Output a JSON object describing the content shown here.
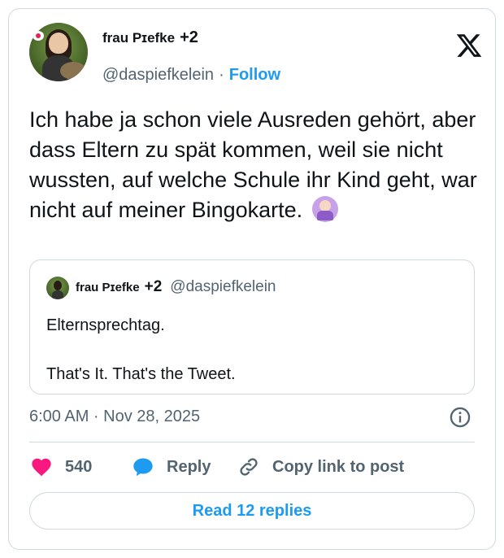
{
  "author": {
    "name": "frau Pɪefke",
    "extra": "+2",
    "handle": "@daspiefkelein",
    "separator": "·",
    "follow_label": "Follow"
  },
  "tweet": {
    "text": "Ich habe ja schon viele Ausreden gehört, aber dass Eltern zu spät kommen, weil sie nicht wussten, auf welche Schule ihr Kind geht, war nicht auf meiner Bingokarte.",
    "emoji": "person-gesturing-no-emoji"
  },
  "quoted": {
    "name": "frau Pɪefke",
    "extra": "+2",
    "handle": "@daspiefkelein",
    "line1": "Elternsprechtag.",
    "line2": "That's It. That's the Tweet."
  },
  "timestamp": "6:00 AM · Nov 28, 2025",
  "actions": {
    "like_count": "540",
    "reply_label": "Reply",
    "copy_label": "Copy link to post"
  },
  "read_replies_label": "Read 12 replies",
  "colors": {
    "accent": "#1d9bf0",
    "heart": "#f91880",
    "muted": "#536471",
    "border": "#cfd9de"
  }
}
